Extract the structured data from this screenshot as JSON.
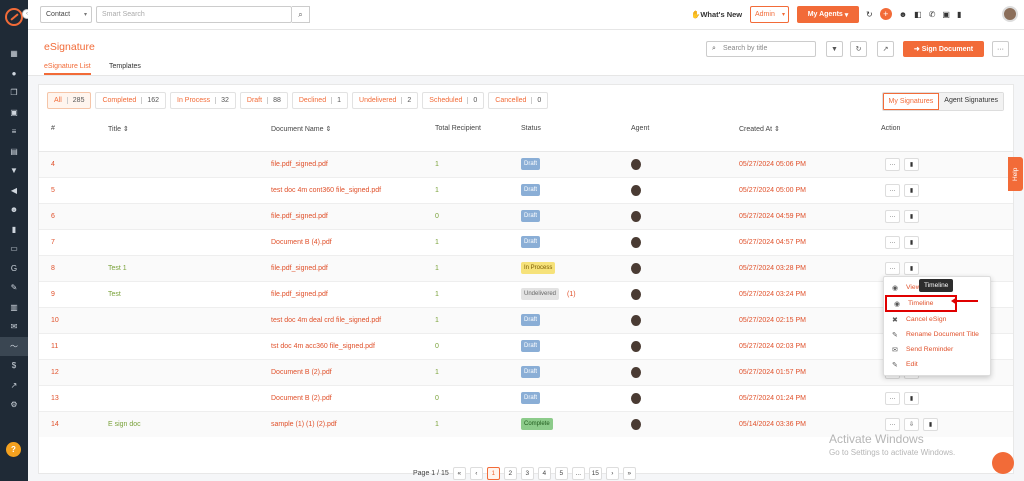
{
  "topbar": {
    "context_value": "Contact",
    "search_placeholder": "Smart Search",
    "whats_new": "What's New",
    "role_value": "Admin",
    "agents_label": "My Agents"
  },
  "header": {
    "title": "eSignature",
    "tabs": [
      "eSignature List",
      "Templates"
    ],
    "search_placeholder": "Search by title",
    "sign_label": "Sign Document"
  },
  "filters": [
    {
      "label": "All",
      "count": "285"
    },
    {
      "label": "Completed",
      "count": "162"
    },
    {
      "label": "In Process",
      "count": "32"
    },
    {
      "label": "Draft",
      "count": "88"
    },
    {
      "label": "Declined",
      "count": "1"
    },
    {
      "label": "Undelivered",
      "count": "2"
    },
    {
      "label": "Scheduled",
      "count": "0"
    },
    {
      "label": "Cancelled",
      "count": "0"
    }
  ],
  "sig_toggle": [
    "My Signatures",
    "Agent Signatures"
  ],
  "columns": [
    "#",
    "Title ⇕",
    "Document Name ⇕",
    "Total Recipient",
    "Status",
    "Agent",
    "Created At ⇕",
    "Action"
  ],
  "rows": [
    {
      "num": "4",
      "title": "",
      "doc": "file.pdf_signed.pdf",
      "recipients": "1",
      "status": "Draft",
      "date": "05/27/2024 05:06 PM"
    },
    {
      "num": "5",
      "title": "",
      "doc": "test doc 4m cont360 file_signed.pdf",
      "recipients": "1",
      "status": "Draft",
      "date": "05/27/2024 05:00 PM"
    },
    {
      "num": "6",
      "title": "",
      "doc": "file.pdf_signed.pdf",
      "recipients": "0",
      "status": "Draft",
      "date": "05/27/2024 04:59 PM"
    },
    {
      "num": "7",
      "title": "",
      "doc": "Document B (4).pdf",
      "recipients": "1",
      "status": "Draft",
      "date": "05/27/2024 04:57 PM"
    },
    {
      "num": "8",
      "title": "Test 1",
      "doc": "file.pdf_signed.pdf",
      "recipients": "1",
      "status": "In Process",
      "date": "05/27/2024 03:28 PM"
    },
    {
      "num": "9",
      "title": "Test",
      "doc": "file.pdf_signed.pdf",
      "recipients": "1",
      "status": "Undelivered",
      "status_count": "(1)",
      "date": "05/27/2024 03:24 PM"
    },
    {
      "num": "10",
      "title": "",
      "doc": "test doc 4m deal crd file_signed.pdf",
      "recipients": "1",
      "status": "Draft",
      "date": "05/27/2024 02:15 PM"
    },
    {
      "num": "11",
      "title": "",
      "doc": "tst doc 4m acc360 file_signed.pdf",
      "recipients": "0",
      "status": "Draft",
      "date": "05/27/2024 02:03 PM"
    },
    {
      "num": "12",
      "title": "",
      "doc": "Document B (2).pdf",
      "recipients": "1",
      "status": "Draft",
      "date": "05/27/2024 01:57 PM"
    },
    {
      "num": "13",
      "title": "",
      "doc": "Document B (2).pdf",
      "recipients": "0",
      "status": "Draft",
      "date": "05/27/2024 01:24 PM"
    },
    {
      "num": "14",
      "title": "E sign doc",
      "doc": "sample (1) (1) (2).pdf",
      "recipients": "1",
      "status": "Complete",
      "date": "05/14/2024 03:36 PM"
    }
  ],
  "menu": {
    "tooltip": "Timeline",
    "items": [
      "View Doc",
      "Timeline",
      "Cancel eSign",
      "Rename Document Title",
      "Send Reminder",
      "Edit"
    ]
  },
  "pager": {
    "label": "Page 1 / 15",
    "pages": [
      "1",
      "2",
      "3",
      "4",
      "5",
      "...",
      "15"
    ]
  },
  "help_label": "Help",
  "watermark": {
    "line1": "Activate Windows",
    "line2": "Go to Settings to activate Windows."
  },
  "colors": {
    "accent": "#f26b38",
    "sidebar": "#1f2a36"
  }
}
